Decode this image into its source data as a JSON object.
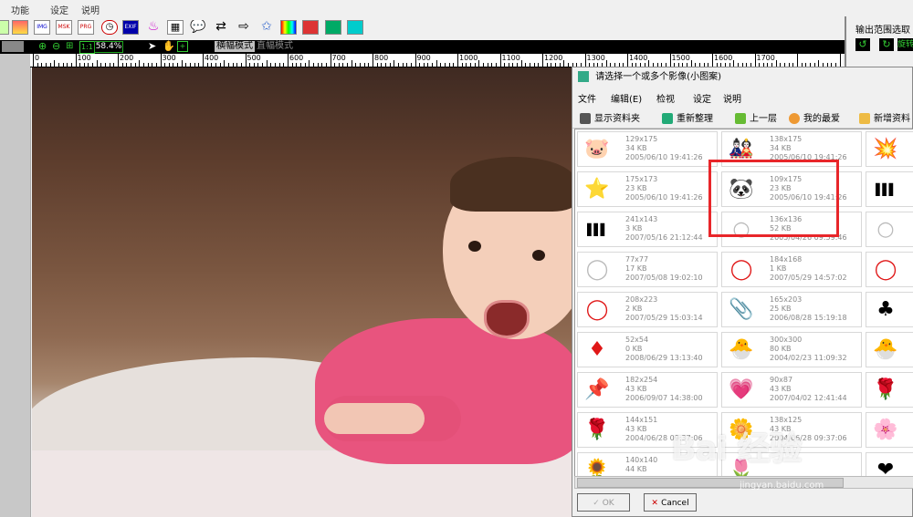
{
  "menu": {
    "items": [
      "功能",
      "设定",
      "说明"
    ]
  },
  "toolbar": {
    "icons": [
      "img-icon",
      "img-label-icon",
      "msk-icon",
      "prg-icon",
      "clock-icon",
      "exif-icon",
      "cake-icon",
      "calendar-icon",
      "speech-icon",
      "arrows-icon",
      "arrow-right-icon",
      "star-icon",
      "palette-icon",
      "edit-icon",
      "picture-icon",
      "monitor-icon"
    ],
    "img_label": "IMG",
    "msk_label": "MSK",
    "prg_label": "PRG",
    "exif_label": "EXIF"
  },
  "statusbar": {
    "zoom": "58.4%",
    "fit_label": "1:1",
    "mode_horizontal": "横幅模式",
    "mode_vertical": "直幅模式"
  },
  "ruler": {
    "labels": [
      "0",
      "100",
      "200",
      "300",
      "400",
      "500",
      "600",
      "700",
      "800",
      "900",
      "1000",
      "1100",
      "1200",
      "1300",
      "1400",
      "1500",
      "1600",
      "1700"
    ]
  },
  "right_panel": {
    "title": "输出范围选取",
    "button": "旋转"
  },
  "dialog": {
    "title": "请选择一个或多个影像(小图案)",
    "menu": [
      "文件",
      "编辑(E)",
      "检视",
      "设定",
      "说明"
    ],
    "toolbar": [
      "显示资料夹",
      "重新整理",
      "上一层",
      "我的最爱",
      "新增资料"
    ],
    "ok": "OK",
    "cancel": "Cancel",
    "items": [
      {
        "icon": "pig",
        "glyph": "🐷",
        "dims": "129x175",
        "size": "34 KB",
        "date": "2005/06/10 19:41:26"
      },
      {
        "icon": "daruma",
        "glyph": "🎎",
        "dims": "138x175",
        "size": "34 KB",
        "date": "2005/06/10 19:41:26"
      },
      {
        "icon": "burst",
        "glyph": "💥",
        "dims": "",
        "size": "",
        "date": ""
      },
      {
        "icon": "star",
        "glyph": "⭐",
        "dims": "175x173",
        "size": "23 KB",
        "date": "2005/06/10 19:41:26"
      },
      {
        "icon": "panda",
        "glyph": "🐼",
        "dims": "109x175",
        "size": "23 KB",
        "date": "2005/06/10 19:41:26"
      },
      {
        "icon": "barcode",
        "glyph": "▌▌▌",
        "dims": "",
        "size": "",
        "date": ""
      },
      {
        "icon": "barcode",
        "glyph": "▌▌▌",
        "dims": "241x143",
        "size": "3 KB",
        "date": "2007/05/16 21:12:44"
      },
      {
        "icon": "bubble",
        "glyph": "○",
        "dims": "136x136",
        "size": "52 KB",
        "date": "2005/04/26 09:59:46"
      },
      {
        "icon": "bubble",
        "glyph": "○",
        "dims": "",
        "size": "",
        "date": ""
      },
      {
        "icon": "bubble",
        "glyph": "◯",
        "dims": "77x77",
        "size": "17 KB",
        "date": "2007/05/08 19:02:10"
      },
      {
        "icon": "red-circle",
        "glyph": "◯",
        "dims": "184x168",
        "size": "1 KB",
        "date": "2007/05/29 14:57:02"
      },
      {
        "icon": "red-circle",
        "glyph": "◯",
        "dims": "",
        "size": "",
        "date": ""
      },
      {
        "icon": "red-circle",
        "glyph": "◯",
        "dims": "208x223",
        "size": "2 KB",
        "date": "2007/05/29 15:03:14"
      },
      {
        "icon": "paperclip",
        "glyph": "📎",
        "dims": "165x203",
        "size": "25 KB",
        "date": "2006/08/28 15:19:18"
      },
      {
        "icon": "club",
        "glyph": "♣",
        "dims": "",
        "size": "",
        "date": ""
      },
      {
        "icon": "diamond",
        "glyph": "♦",
        "dims": "52x54",
        "size": "0 KB",
        "date": "2008/06/29 13:13:40"
      },
      {
        "icon": "chick",
        "glyph": "🐣",
        "dims": "300x300",
        "size": "80 KB",
        "date": "2004/02/23 11:09:32"
      },
      {
        "icon": "chick",
        "glyph": "🐣",
        "dims": "",
        "size": "",
        "date": ""
      },
      {
        "icon": "pushpin",
        "glyph": "📌",
        "dims": "182x254",
        "size": "43 KB",
        "date": "2006/09/07 14:38:00"
      },
      {
        "icon": "hello-kitty",
        "glyph": "💗",
        "dims": "90x87",
        "size": "43 KB",
        "date": "2007/04/02 12:41:44"
      },
      {
        "icon": "rose",
        "glyph": "🌹",
        "dims": "",
        "size": "",
        "date": ""
      },
      {
        "icon": "rose",
        "glyph": "🌹",
        "dims": "144x151",
        "size": "43 KB",
        "date": "2004/06/28 09:37:06"
      },
      {
        "icon": "yellow-rose",
        "glyph": "🌼",
        "dims": "138x125",
        "size": "43 KB",
        "date": "2004/06/28 09:37:06"
      },
      {
        "icon": "pink-flowers",
        "glyph": "🌸",
        "dims": "",
        "size": "",
        "date": ""
      },
      {
        "icon": "sunflower",
        "glyph": "🌻",
        "dims": "140x140",
        "size": "44 KB",
        "date": ""
      },
      {
        "icon": "flower",
        "glyph": "🌷",
        "dims": "",
        "size": "",
        "date": ""
      },
      {
        "icon": "heart",
        "glyph": "❤",
        "dims": "",
        "size": "",
        "date": ""
      }
    ]
  },
  "watermark": {
    "text": "Bai 经验",
    "url": "jingyan.baidu.com"
  },
  "colors": {
    "highlight": "#e8262a",
    "black_bar": "#000000",
    "mode_active": "#c0c0c0"
  }
}
